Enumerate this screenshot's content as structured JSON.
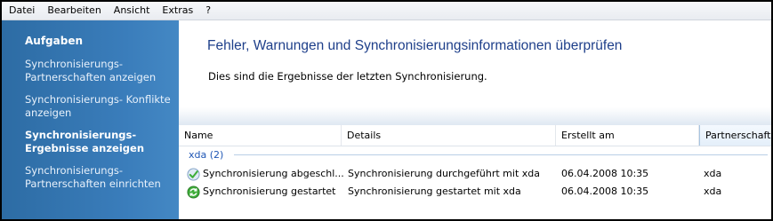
{
  "menu": [
    "Datei",
    "Bearbeiten",
    "Ansicht",
    "Extras",
    "?"
  ],
  "sidebar": {
    "heading": "Aufgaben",
    "links": [
      {
        "line1": "Synchronisierungs-",
        "line2": "Partnerschaften anzeigen",
        "active": false
      },
      {
        "line1": "Synchronisierungs- Konflikte",
        "line2": "anzeigen",
        "active": false
      },
      {
        "line1": "Synchronisierungs-",
        "line2": "Ergebnisse anzeigen",
        "active": true
      },
      {
        "line1": "Synchronisierungs-",
        "line2": "Partnerschaften einrichten",
        "active": false
      }
    ]
  },
  "main": {
    "title": "Fehler, Warnungen und Synchronisierungsinformationen überprüfen",
    "subtitle": "Dies sind die Ergebnisse der letzten Synchronisierung."
  },
  "table": {
    "columns": [
      "Name",
      "Details",
      "Erstellt am",
      "Partnerschaft"
    ],
    "group_label": "xda (2)",
    "rows": [
      {
        "icon": "sync-complete-icon",
        "name": "Synchronisierung abgeschl...",
        "details": "Synchronisierung durchgeführt mit xda",
        "created": "06.04.2008 10:35",
        "partner": "xda"
      },
      {
        "icon": "sync-started-icon",
        "name": "Synchronisierung gestartet",
        "details": "Synchronisierung gestartet mit xda",
        "created": "06.04.2008 10:35",
        "partner": "xda"
      }
    ]
  },
  "colors": {
    "sidebar_bg": "#3a7dbb",
    "title_text": "#1e3f8a",
    "group_text": "#1f56b5",
    "check_green": "#3fae3a"
  }
}
